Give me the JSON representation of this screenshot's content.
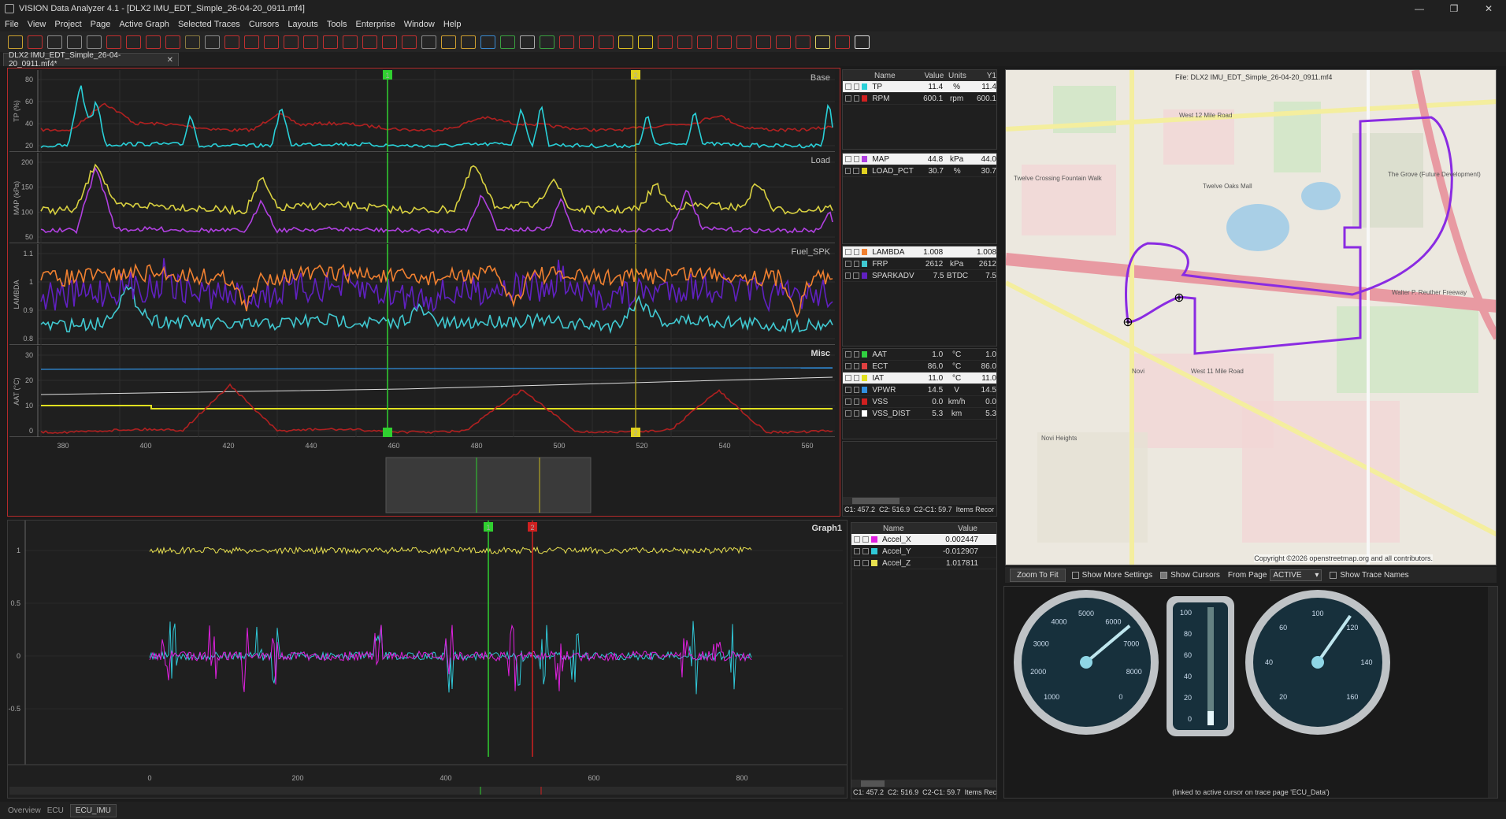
{
  "window": {
    "title": "VISION Data Analyzer 4.1  - [DLX2 IMU_EDT_Simple_26-04-20_0911.mf4]",
    "min": "—",
    "max": "❐",
    "close": "✕"
  },
  "menu": [
    "File",
    "View",
    "Project",
    "Page",
    "Active Graph",
    "Selected Traces",
    "Cursors",
    "Layouts",
    "Tools",
    "Enterprise",
    "Window",
    "Help"
  ],
  "tab": {
    "label": "DLX2 IMU_EDT_Simple_26-04-20_0911.mf4*",
    "close": "✕"
  },
  "plots": [
    {
      "label": "Base",
      "ylabel": "TP (%)",
      "ticks": [
        "80",
        "60",
        "40",
        "20"
      ]
    },
    {
      "label": "Load",
      "ylabel": "MAP (kPa)",
      "ticks": [
        "200",
        "150",
        "100",
        "50"
      ]
    },
    {
      "label": "Fuel_SPK",
      "ylabel": "LAMBDA",
      "ticks": [
        "1.1",
        "1",
        "0.9",
        "0.8"
      ]
    },
    {
      "label": "Misc",
      "ylabel": "AAT (°C)",
      "ticks": [
        "30",
        "20",
        "10",
        "0"
      ]
    }
  ],
  "xaxis_upper": [
    "380",
    "400",
    "420",
    "440",
    "460",
    "480",
    "500",
    "520",
    "540",
    "560"
  ],
  "cursors": {
    "c1": "1",
    "c2": "2"
  },
  "channels_header": {
    "name": "Name",
    "value": "Value",
    "units": "Units",
    "y1": "Y1"
  },
  "channel_groups": [
    [
      {
        "name": "TP",
        "value": "11.4",
        "units": "%",
        "y1": "11.4",
        "color": "#29d0d8",
        "hl": true
      },
      {
        "name": "RPM",
        "value": "600.1",
        "units": "rpm",
        "y1": "600.1",
        "color": "#d02020"
      }
    ],
    [
      {
        "name": "MAP",
        "value": "44.8",
        "units": "kPa",
        "y1": "44.0",
        "color": "#b040e0",
        "hl": true
      },
      {
        "name": "LOAD_PCT",
        "value": "30.7",
        "units": "%",
        "y1": "30.7",
        "color": "#e0d020"
      }
    ],
    [
      {
        "name": "LAMBDA",
        "value": "1.008",
        "units": "",
        "y1": "1.008",
        "color": "#f08030",
        "hl": true
      },
      {
        "name": "FRP",
        "value": "2612",
        "units": "kPa",
        "y1": "2612",
        "color": "#40c8d0"
      },
      {
        "name": "SPARKADV",
        "value": "7.5",
        "units": "BTDC",
        "y1": "7.5",
        "color": "#6020c0"
      }
    ],
    [
      {
        "name": "AAT",
        "value": "1.0",
        "units": "°C",
        "y1": "1.0",
        "color": "#30d040"
      },
      {
        "name": "ECT",
        "value": "86.0",
        "units": "°C",
        "y1": "86.0",
        "color": "#e04040"
      },
      {
        "name": "IAT",
        "value": "11.0",
        "units": "°C",
        "y1": "11.0",
        "color": "#e0e020",
        "hl": true
      },
      {
        "name": "VPWR",
        "value": "14.5",
        "units": "V",
        "y1": "14.5",
        "color": "#3090e0"
      },
      {
        "name": "VSS",
        "value": "0.0",
        "units": "km/h",
        "y1": "0.0",
        "color": "#d02020"
      },
      {
        "name": "VSS_DIST",
        "value": "5.3",
        "units": "km",
        "y1": "5.3",
        "color": "#ffffff"
      }
    ]
  ],
  "upper_status": {
    "c1": "C1: 457.2",
    "c2": "C2: 516.9",
    "diff": "C2-C1: 59.7",
    "items": "Items Recor"
  },
  "graph1": {
    "label": "Graph1",
    "ticks": [
      "1",
      "0.5",
      "0",
      "-0.5"
    ],
    "xaxis": [
      "0",
      "200",
      "400",
      "600",
      "800"
    ],
    "header": {
      "name": "Name",
      "value": "Value"
    },
    "channels": [
      {
        "name": "Accel_X",
        "value": "0.002447",
        "color": "#e020e0",
        "hl": true
      },
      {
        "name": "Accel_Y",
        "value": "-0.012907",
        "color": "#30c8d8"
      },
      {
        "name": "Accel_Z",
        "value": "1.017811",
        "color": "#e8e050"
      }
    ],
    "status": {
      "c1": "C1: 457.2",
      "c2": "C2: 516.9",
      "diff": "C2-C1: 59.7",
      "items": "Items Rec"
    }
  },
  "map": {
    "file_label": "File:  DLX2 IMU_EDT_Simple_26-04-20_0911.mf4",
    "copyright": "Copyright ©2026 openstreetmap.org and all contributors.",
    "labels": [
      "West 12 Mile Road",
      "Twelve Oaks Mall",
      "Walter P. Reuther Freeway",
      "Novi",
      "West 11 Mile Road",
      "The Grove (Future Development)",
      "Twelve Crossing Fountain Walk",
      "Novi Heights"
    ],
    "zoom_button": "Zoom To Fit",
    "show_more": "Show More Settings",
    "show_cursors": "Show Cursors",
    "from_page": "From Page",
    "page_value": "ACTIVE",
    "show_names": "Show Trace Names"
  },
  "gauges": {
    "rpm": [
      "1000",
      "2000",
      "3000",
      "4000",
      "5000",
      "6000",
      "7000",
      "8000",
      "0"
    ],
    "tp": [
      "100",
      "80",
      "60",
      "40",
      "20",
      "0"
    ],
    "vss": [
      "20",
      "40",
      "60",
      "100",
      "120",
      "140",
      "160"
    ],
    "link_note": "(linked to active cursor on trace page 'ECU_Data')"
  },
  "status_tabs": [
    "Overview",
    "ECU",
    "ECU_IMU"
  ]
}
